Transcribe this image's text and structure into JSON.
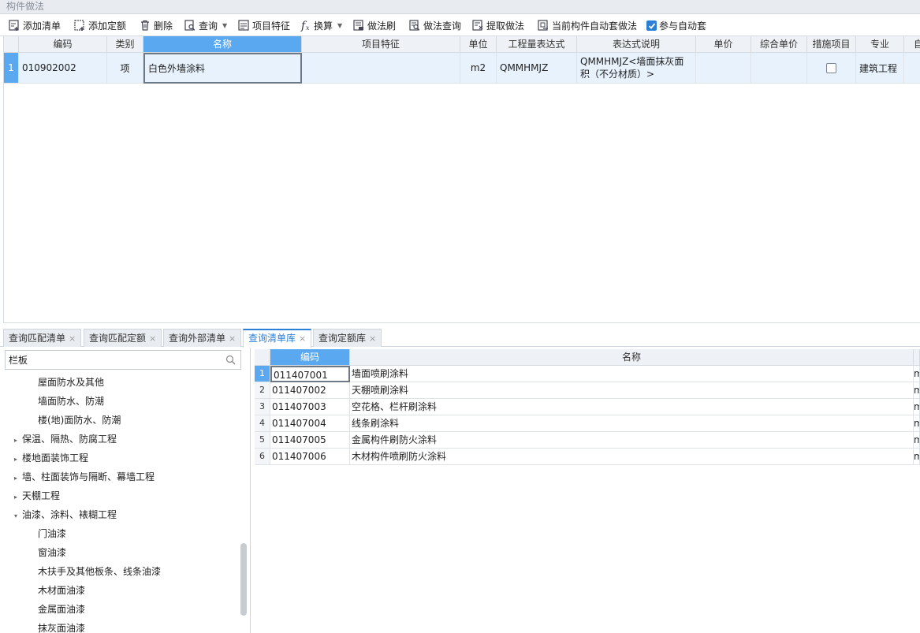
{
  "panel_title": "构件做法",
  "toolbar": {
    "add_list": "添加清单",
    "add_quota": "添加定额",
    "delete": "删除",
    "query": "查询",
    "item_features": "项目特征",
    "convert": "换算",
    "method_brush": "做法刷",
    "method_query": "做法查询",
    "extract_method": "提取做法",
    "auto_set": "当前构件自动套做法",
    "participate_auto": "参与自动套"
  },
  "top_grid": {
    "headers": [
      "编码",
      "类别",
      "名称",
      "项目特征",
      "单位",
      "工程量表达式",
      "表达式说明",
      "单价",
      "综合单价",
      "措施项目",
      "专业",
      "自"
    ],
    "rows": [
      {
        "num": "1",
        "code": "010902002",
        "type": "项",
        "name": "白色外墙涂料",
        "features": "",
        "unit": "m2",
        "expr": "QMMHMJZ",
        "expr_desc": "QMMHMJZ<墙面抹灰面积（不分材质）>",
        "price": "",
        "comp_price": "",
        "measure": false,
        "specialty": "建筑工程"
      }
    ]
  },
  "tabs": [
    {
      "label": "查询匹配清单",
      "active": false
    },
    {
      "label": "查询匹配定额",
      "active": false
    },
    {
      "label": "查询外部清单",
      "active": false
    },
    {
      "label": "查询清单库",
      "active": true
    },
    {
      "label": "查询定额库",
      "active": false
    }
  ],
  "tab_close": "×",
  "search": {
    "value": "栏板"
  },
  "tree": [
    {
      "label": "屋面防水及其他",
      "level": 2,
      "arrow": ""
    },
    {
      "label": "墙面防水、防潮",
      "level": 2,
      "arrow": ""
    },
    {
      "label": "楼(地)面防水、防潮",
      "level": 2,
      "arrow": ""
    },
    {
      "label": "保温、隔热、防腐工程",
      "level": 1,
      "arrow": "▸"
    },
    {
      "label": "楼地面装饰工程",
      "level": 1,
      "arrow": "▸"
    },
    {
      "label": "墙、柱面装饰与隔断、幕墙工程",
      "level": 1,
      "arrow": "▸"
    },
    {
      "label": "天棚工程",
      "level": 1,
      "arrow": "▸"
    },
    {
      "label": "油漆、涂料、裱糊工程",
      "level": 1,
      "arrow": "▾"
    },
    {
      "label": "门油漆",
      "level": 2,
      "arrow": ""
    },
    {
      "label": "窗油漆",
      "level": 2,
      "arrow": ""
    },
    {
      "label": "木扶手及其他板条、线条油漆",
      "level": 2,
      "arrow": ""
    },
    {
      "label": "木材面油漆",
      "level": 2,
      "arrow": ""
    },
    {
      "label": "金属面油漆",
      "level": 2,
      "arrow": ""
    },
    {
      "label": "抹灰面油漆",
      "level": 2,
      "arrow": ""
    }
  ],
  "bottom_grid": {
    "headers": [
      "编码",
      "名称"
    ],
    "rows": [
      {
        "num": "1",
        "code": "011407001",
        "name": "墙面喷刷涂料",
        "unit": "m"
      },
      {
        "num": "2",
        "code": "011407002",
        "name": "天棚喷刷涂料",
        "unit": "m"
      },
      {
        "num": "3",
        "code": "011407003",
        "name": "空花格、栏杆刷涂料",
        "unit": "m"
      },
      {
        "num": "4",
        "code": "011407004",
        "name": "线条刷涂料",
        "unit": "m"
      },
      {
        "num": "5",
        "code": "011407005",
        "name": "金属构件刷防火涂料",
        "unit": "m"
      },
      {
        "num": "6",
        "code": "011407006",
        "name": "木材构件喷刷防火涂料",
        "unit": "m"
      }
    ]
  }
}
